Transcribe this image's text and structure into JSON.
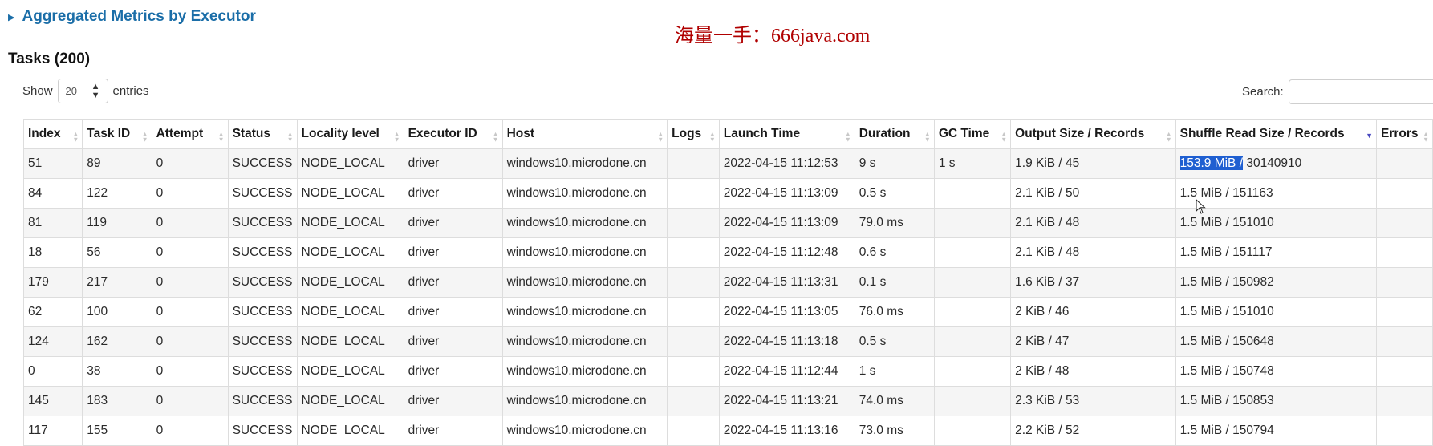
{
  "aggregated": {
    "title": "Aggregated Metrics by Executor"
  },
  "watermark": "海量一手：666java.com",
  "tasks": {
    "title": "Tasks (200)",
    "show_label": "Show",
    "entries_label": "entries",
    "page_length": "20",
    "search_label": "Search:",
    "search_value": "",
    "columns": [
      "Index",
      "Task ID",
      "Attempt",
      "Status",
      "Locality level",
      "Executor ID",
      "Host",
      "Logs",
      "Launch Time",
      "Duration",
      "GC Time",
      "Output Size / Records",
      "Shuffle Read Size / Records",
      "Errors"
    ],
    "rows": [
      [
        "51",
        "89",
        "0",
        "SUCCESS",
        "NODE_LOCAL",
        "driver",
        "windows10.microdone.cn",
        "",
        "2022-04-15 11:12:53",
        "9 s",
        "1 s",
        "1.9 KiB / 45",
        "153.9 MiB / 30140910",
        ""
      ],
      [
        "84",
        "122",
        "0",
        "SUCCESS",
        "NODE_LOCAL",
        "driver",
        "windows10.microdone.cn",
        "",
        "2022-04-15 11:13:09",
        "0.5 s",
        "",
        "2.1 KiB / 50",
        "1.5 MiB / 151163",
        ""
      ],
      [
        "81",
        "119",
        "0",
        "SUCCESS",
        "NODE_LOCAL",
        "driver",
        "windows10.microdone.cn",
        "",
        "2022-04-15 11:13:09",
        "79.0 ms",
        "",
        "2.1 KiB / 48",
        "1.5 MiB / 151010",
        ""
      ],
      [
        "18",
        "56",
        "0",
        "SUCCESS",
        "NODE_LOCAL",
        "driver",
        "windows10.microdone.cn",
        "",
        "2022-04-15 11:12:48",
        "0.6 s",
        "",
        "2.1 KiB / 48",
        "1.5 MiB / 151117",
        ""
      ],
      [
        "179",
        "217",
        "0",
        "SUCCESS",
        "NODE_LOCAL",
        "driver",
        "windows10.microdone.cn",
        "",
        "2022-04-15 11:13:31",
        "0.1 s",
        "",
        "1.6 KiB / 37",
        "1.5 MiB / 150982",
        ""
      ],
      [
        "62",
        "100",
        "0",
        "SUCCESS",
        "NODE_LOCAL",
        "driver",
        "windows10.microdone.cn",
        "",
        "2022-04-15 11:13:05",
        "76.0 ms",
        "",
        "2 KiB / 46",
        "1.5 MiB / 151010",
        ""
      ],
      [
        "124",
        "162",
        "0",
        "SUCCESS",
        "NODE_LOCAL",
        "driver",
        "windows10.microdone.cn",
        "",
        "2022-04-15 11:13:18",
        "0.5 s",
        "",
        "2 KiB / 47",
        "1.5 MiB / 150648",
        ""
      ],
      [
        "0",
        "38",
        "0",
        "SUCCESS",
        "NODE_LOCAL",
        "driver",
        "windows10.microdone.cn",
        "",
        "2022-04-15 11:12:44",
        "1 s",
        "",
        "2 KiB / 48",
        "1.5 MiB / 150748",
        ""
      ],
      [
        "145",
        "183",
        "0",
        "SUCCESS",
        "NODE_LOCAL",
        "driver",
        "windows10.microdone.cn",
        "",
        "2022-04-15 11:13:21",
        "74.0 ms",
        "",
        "2.3 KiB / 53",
        "1.5 MiB / 150853",
        ""
      ],
      [
        "117",
        "155",
        "0",
        "SUCCESS",
        "NODE_LOCAL",
        "driver",
        "windows10.microdone.cn",
        "",
        "2022-04-15 11:13:16",
        "73.0 ms",
        "",
        "2.2 KiB / 52",
        "1.5 MiB / 150794",
        ""
      ]
    ],
    "highlighted_text": "153.9 MiB /"
  },
  "colors": {
    "link": "#1b6ea8",
    "watermark": "#b00000",
    "selection": "#1f5fd1",
    "stripe": "#f5f5f5"
  },
  "icons": {
    "collapse": "triangle-right-icon",
    "sort": "sort-both-icon",
    "sort_desc": "sort-desc-icon",
    "select": "up-down-icon"
  }
}
